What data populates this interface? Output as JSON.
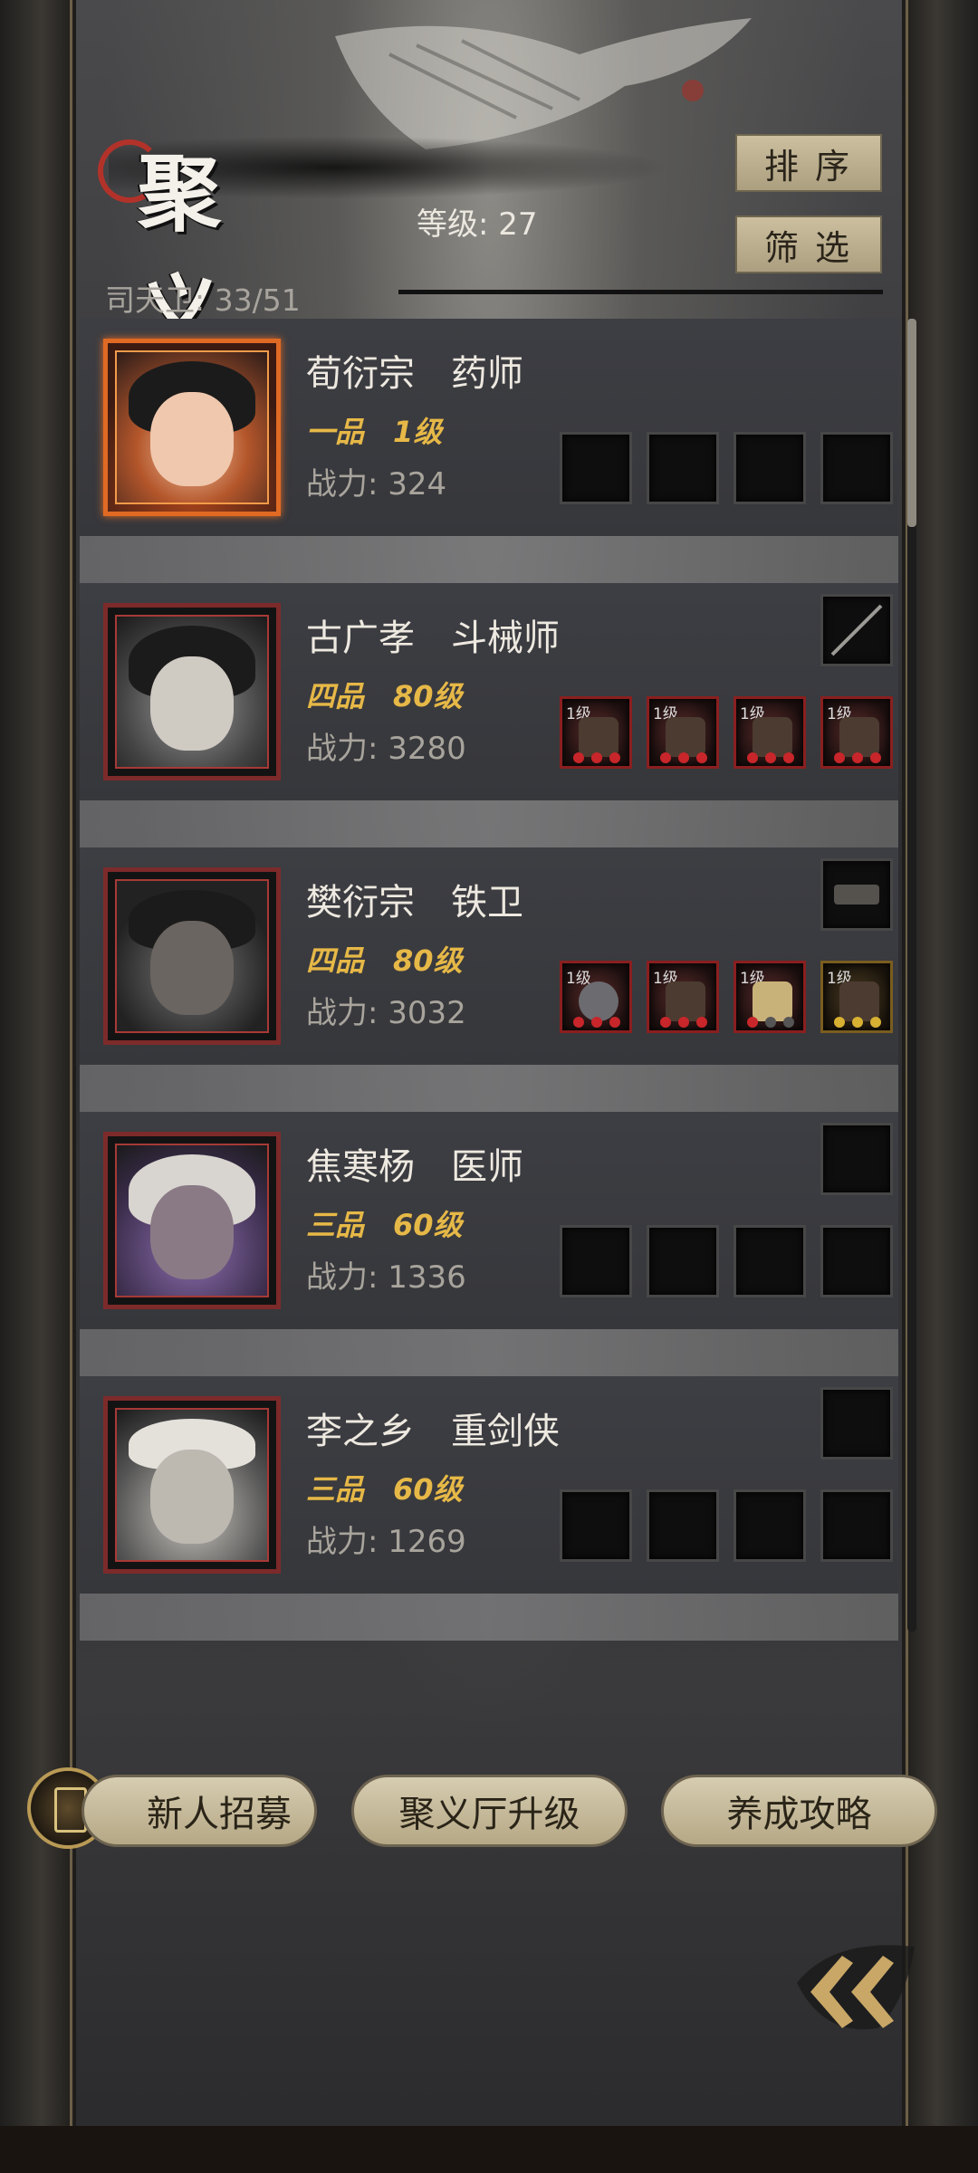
{
  "header": {
    "title": "聚义厅",
    "level_label": "等级: 27",
    "guards_label": "司天卫: 33/51",
    "sort_label": "排序",
    "filter_label": "筛选"
  },
  "heroes": [
    {
      "name": "荀衍宗　药师",
      "rank": "一品　1级",
      "power": "战力: 324",
      "slot_labels": [
        "",
        "",
        "",
        ""
      ],
      "has_weapon": false
    },
    {
      "name": "古广孝　斗械师",
      "rank": "四品　80级",
      "power": "战力: 3280",
      "slot_labels": [
        "1级",
        "1级",
        "1级",
        "1级"
      ],
      "has_weapon": true
    },
    {
      "name": "樊衍宗　铁卫",
      "rank": "四品　80级",
      "power": "战力: 3032",
      "slot_labels": [
        "1级",
        "1级",
        "1级",
        "1级"
      ],
      "has_weapon": true
    },
    {
      "name": "焦寒杨　医师",
      "rank": "三品　60级",
      "power": "战力: 1336",
      "slot_labels": [
        "",
        "",
        "",
        ""
      ],
      "has_weapon": false
    },
    {
      "name": "李之乡　重剑侠",
      "rank": "三品　60级",
      "power": "战力: 1269",
      "slot_labels": [
        "",
        "",
        "",
        ""
      ],
      "has_weapon": false
    }
  ],
  "footer": {
    "recruit_label": "新人招募",
    "upgrade_label": "聚义厅升级",
    "guide_label": "养成攻略"
  }
}
